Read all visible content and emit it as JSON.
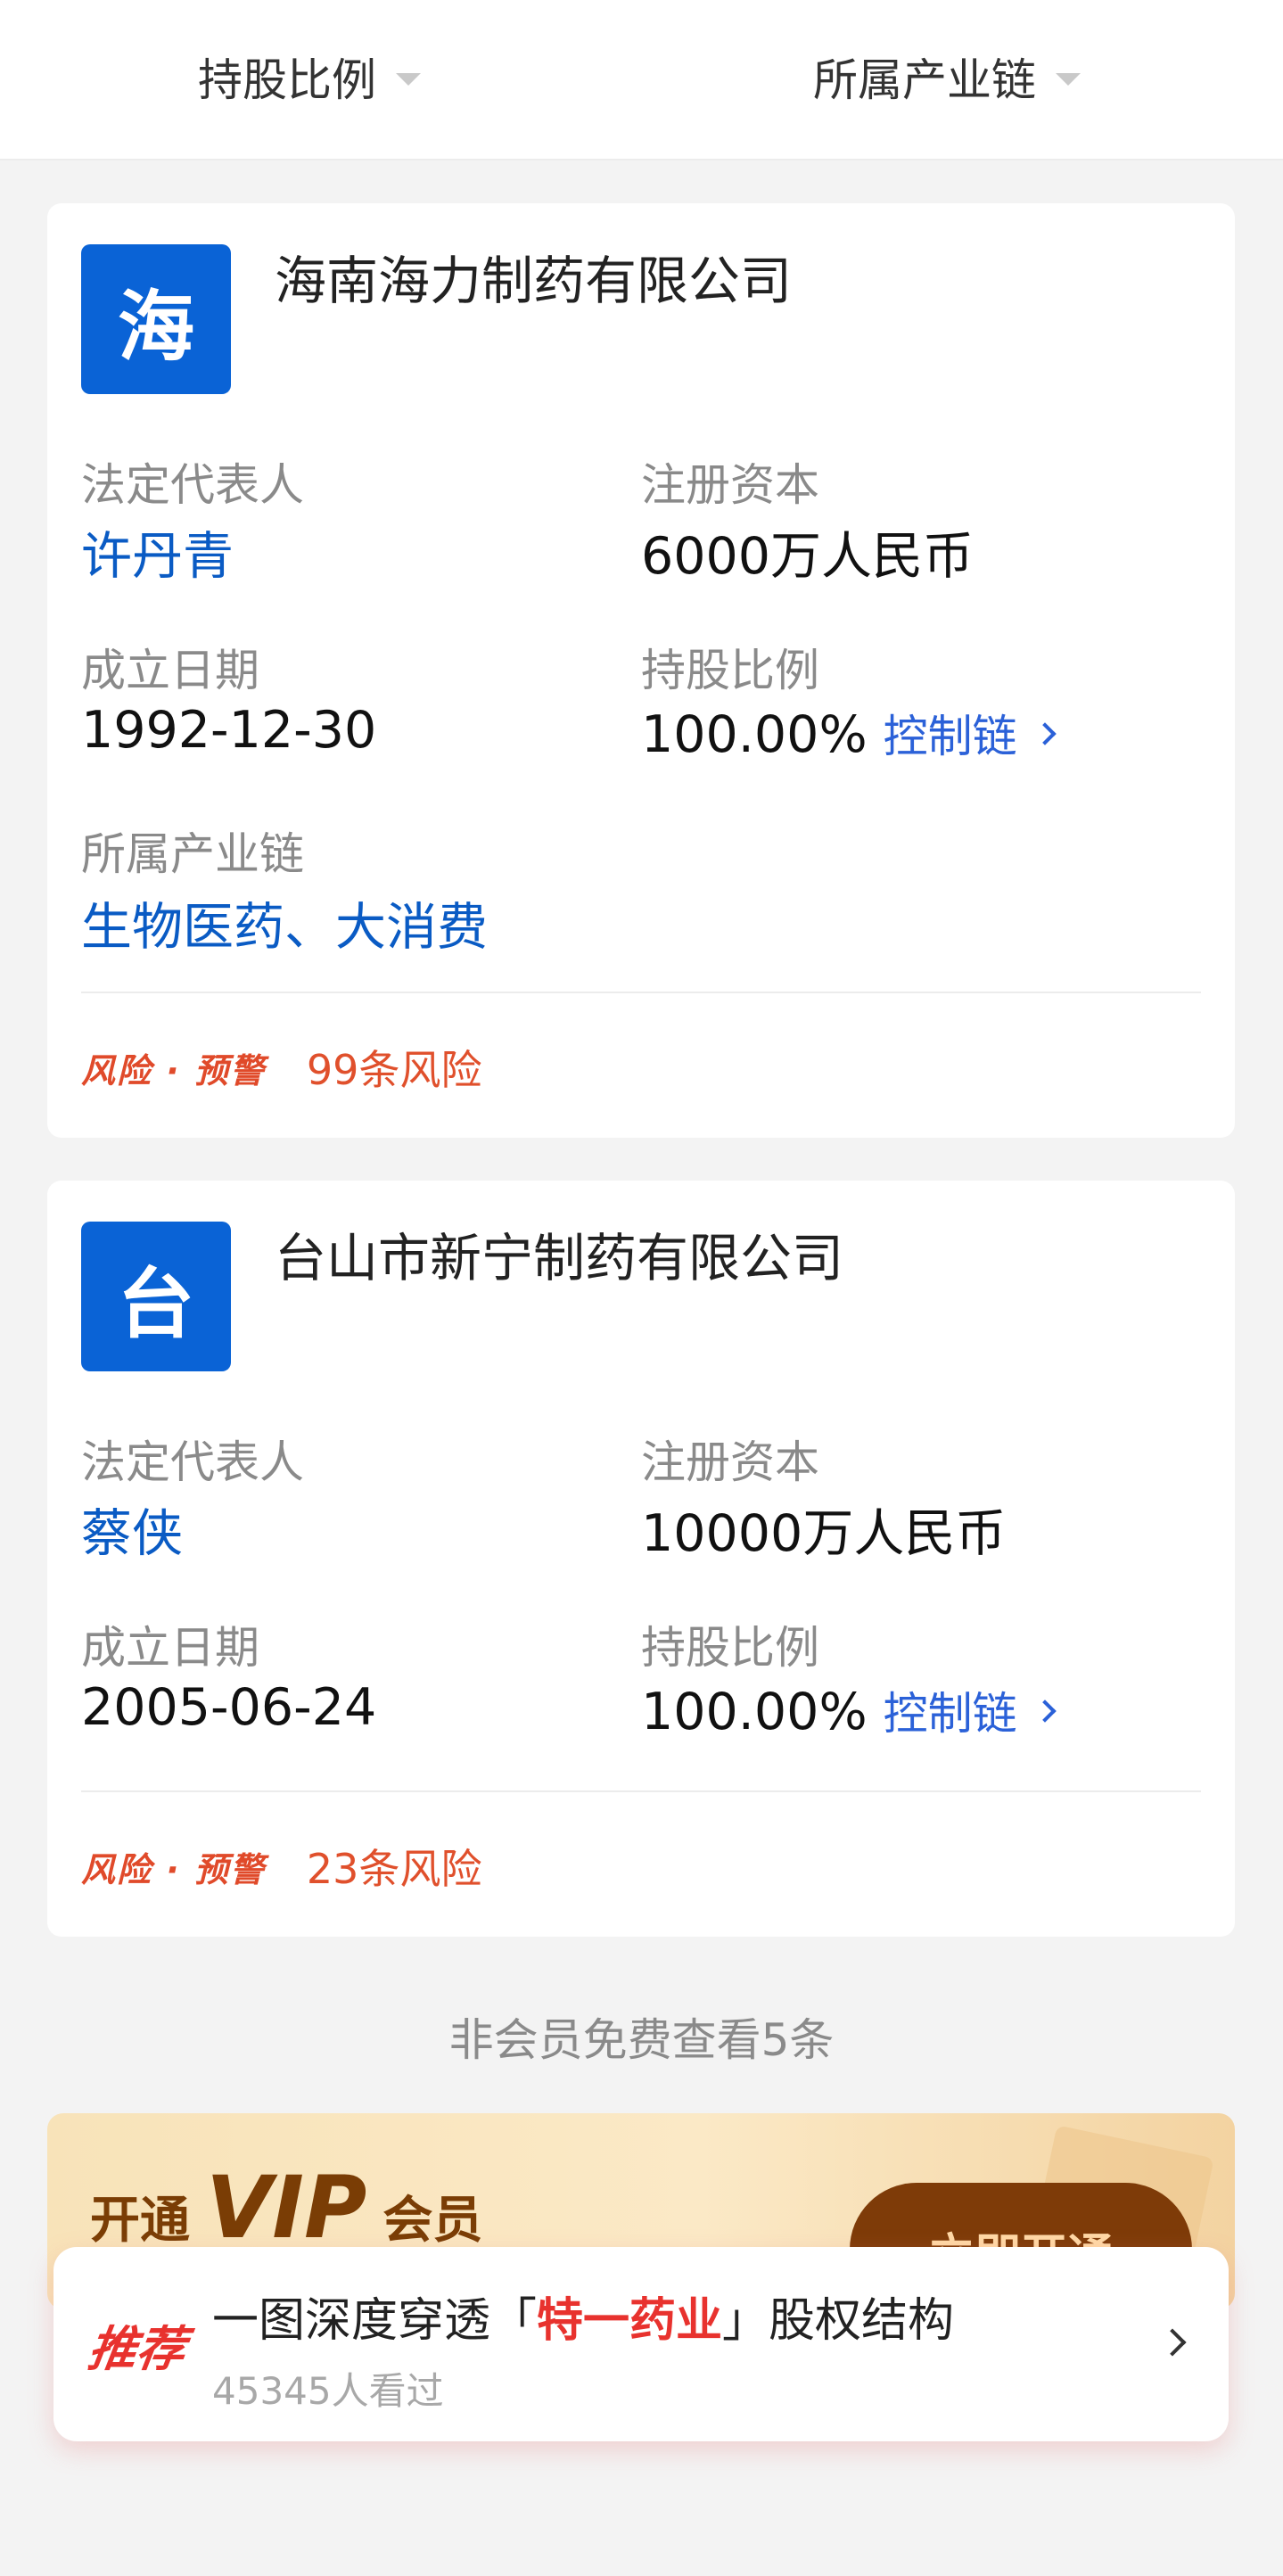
{
  "filters": {
    "shareholding_label": "持股比例",
    "industry_chain_label": "所属产业链"
  },
  "companies": [
    {
      "logo_char": "海",
      "name": "海南海力制药有限公司",
      "legal_rep_label": "法定代表人",
      "legal_rep": "许丹青",
      "reg_capital_label": "注册资本",
      "reg_capital": "6000万人民币",
      "founded_label": "成立日期",
      "founded": "1992-12-30",
      "share_label": "持股比例",
      "share": "100.00%",
      "control_chain": "控制链",
      "industry_label": "所属产业链",
      "industry": "生物医药、大消费",
      "risk_tag": "风险 · 预警",
      "risk_count": "99条风险"
    },
    {
      "logo_char": "台",
      "name": "台山市新宁制药有限公司",
      "legal_rep_label": "法定代表人",
      "legal_rep": "蔡侠",
      "reg_capital_label": "注册资本",
      "reg_capital": "10000万人民币",
      "founded_label": "成立日期",
      "founded": "2005-06-24",
      "share_label": "持股比例",
      "share": "100.00%",
      "control_chain": "控制链",
      "risk_tag": "风险 · 预警",
      "risk_count": "23条风险"
    }
  ],
  "free_note": "非会员免费查看5条",
  "vip": {
    "prefix": "开通",
    "vip": "VIP",
    "suffix": "会员",
    "button": "立即开通"
  },
  "recommend": {
    "badge": "推荐",
    "title_before": "一图深度穿透「",
    "title_highlight": "特一药业",
    "title_after": "」股权结构",
    "views": "45345人看过"
  },
  "colors": {
    "brand_blue": "#0a63d6",
    "link_blue": "#2b61d8",
    "risk_red": "#e0502c",
    "vip_brown": "#7a3d05"
  },
  "icons": [
    "caret-down-icon",
    "chevron-right-icon"
  ]
}
